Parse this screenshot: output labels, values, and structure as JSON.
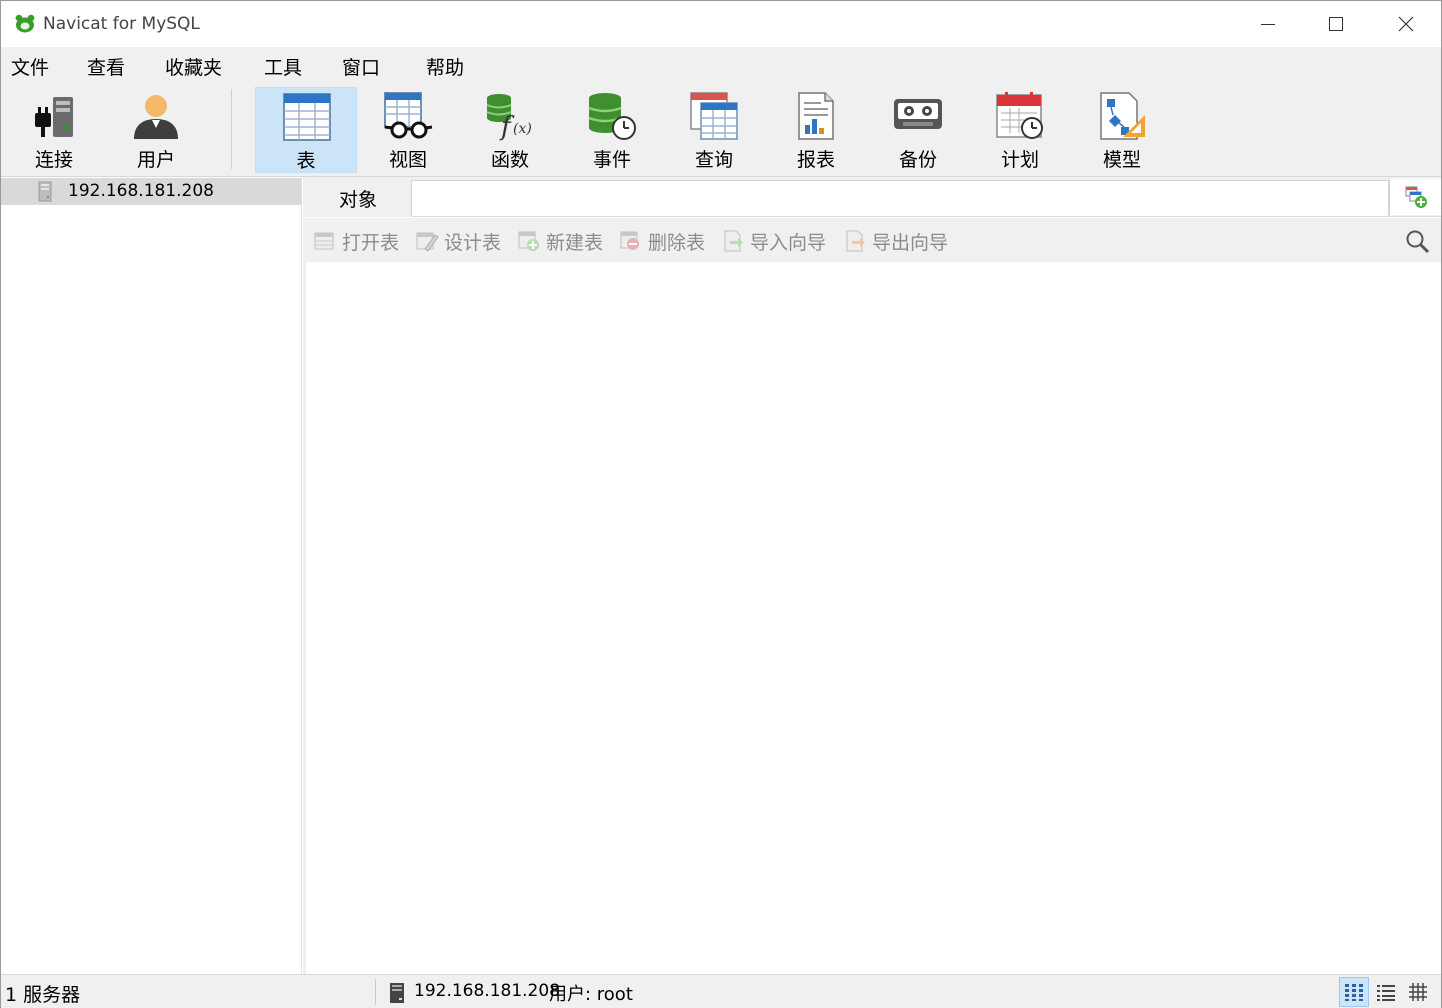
{
  "window": {
    "title": "Navicat for MySQL"
  },
  "menu": [
    "文件",
    "查看",
    "收藏夹",
    "工具",
    "窗口",
    "帮助"
  ],
  "toolbar": {
    "connect": "连接",
    "user": "用户",
    "table": "表",
    "view": "视图",
    "function": "函数",
    "event": "事件",
    "query": "查询",
    "report": "报表",
    "backup": "备份",
    "schedule": "计划",
    "model": "模型",
    "active": "表"
  },
  "connections": [
    {
      "label": "192.168.181.208",
      "selected": true
    }
  ],
  "object_tab": {
    "label": "对象"
  },
  "object_toolbar": {
    "open_table": "打开表",
    "design_table": "设计表",
    "new_table": "新建表",
    "delete_table": "删除表",
    "import_wizard": "导入向导",
    "export_wizard": "导出向导"
  },
  "status": {
    "server_count": "1 服务器",
    "host": "192.168.181.208",
    "user": "用户: root"
  },
  "colors": {
    "chrome": "#f0f0f0",
    "active_button": "#cce4f7",
    "selected_item": "#d9d9d9",
    "logo_green": "#3a9c2a"
  }
}
